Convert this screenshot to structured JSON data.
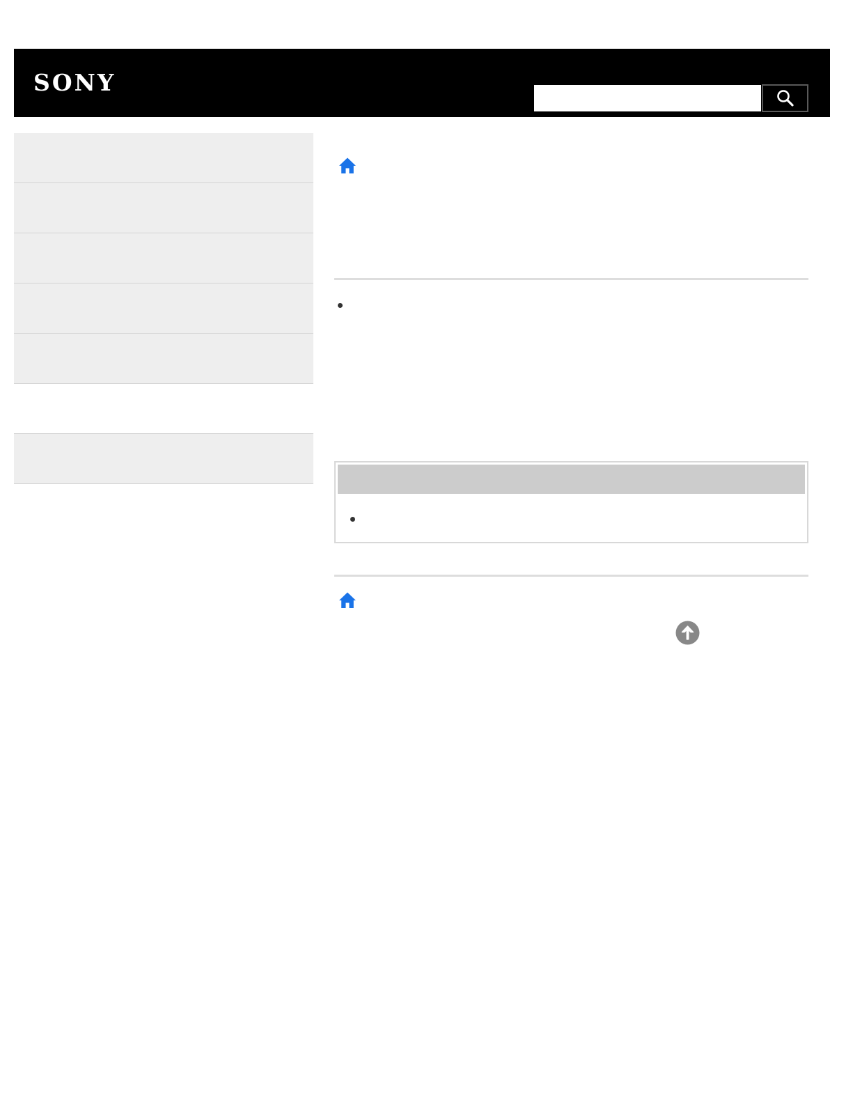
{
  "header": {
    "logo_text": "SONY",
    "brand_color": "#000000"
  },
  "search": {
    "value": "",
    "button_icon": "search-icon"
  },
  "sidebar": {
    "items": [
      {
        "label": ""
      },
      {
        "label": ""
      },
      {
        "label": ""
      },
      {
        "label": ""
      },
      {
        "label": ""
      },
      {
        "label": ""
      },
      {
        "label": ""
      }
    ]
  },
  "main": {
    "home_icon": "home-icon",
    "home_icon_color": "#1a73e8",
    "note": {
      "title": ""
    },
    "back_to_top_icon": "arrow-up-circle-icon",
    "back_to_top_color": "#888888"
  }
}
